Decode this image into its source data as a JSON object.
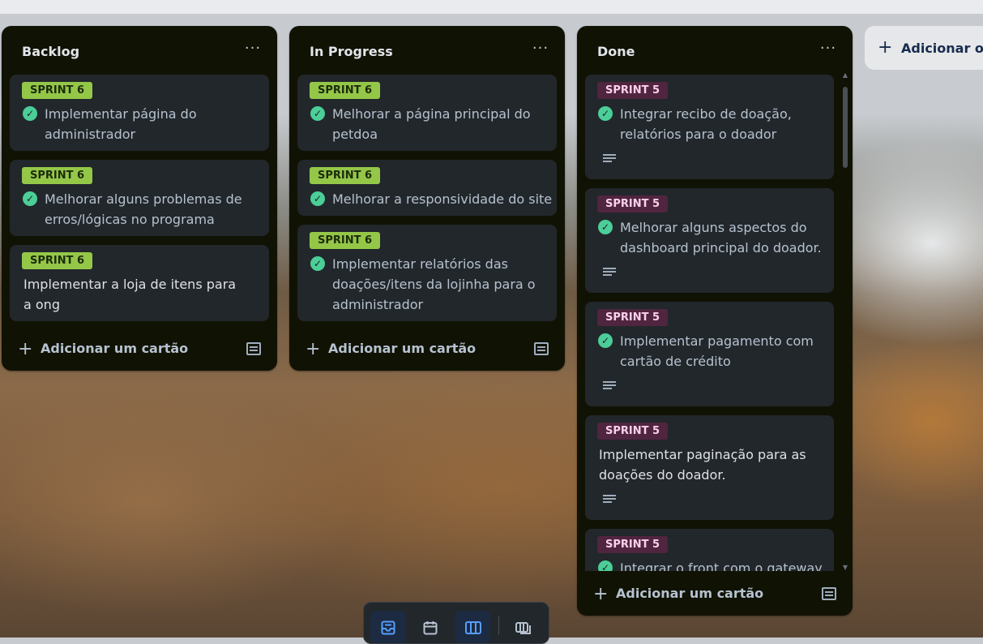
{
  "lists": [
    {
      "title": "Backlog",
      "menu": "···",
      "add_label": "Adicionar um cartão",
      "cards": [
        {
          "label": "SPRINT 6",
          "done": true,
          "lines": [
            "Implementar página do",
            "administrador"
          ]
        },
        {
          "label": "SPRINT 6",
          "done": true,
          "lines": [
            "Melhorar alguns problemas de",
            "erros/lógicas no programa"
          ]
        },
        {
          "label": "SPRINT 6",
          "done": false,
          "lines": [
            "Implementar a loja de itens para",
            "a ong"
          ]
        }
      ]
    },
    {
      "title": "In Progress",
      "menu": "···",
      "add_label": "Adicionar um cartão",
      "cards": [
        {
          "label": "SPRINT 6",
          "done": true,
          "lines": [
            "Melhorar a página principal do",
            "petdoa"
          ]
        },
        {
          "label": "SPRINT 6",
          "done": true,
          "lines": [
            "Melhorar a responsividade do site"
          ]
        },
        {
          "label": "SPRINT 6",
          "done": true,
          "lines": [
            "Implementar relatórios das",
            "doações/itens da lojinha para o",
            "administrador"
          ]
        }
      ]
    },
    {
      "title": "Done",
      "menu": "···",
      "add_label": "Adicionar um cartão",
      "cards": [
        {
          "label": "SPRINT 5",
          "done": true,
          "lines": [
            "Integrar recibo de doação,",
            "relatórios para o doador"
          ],
          "has_description": true
        },
        {
          "label": "SPRINT 5",
          "done": true,
          "lines": [
            "Melhorar alguns aspectos do",
            "dashboard principal do doador."
          ],
          "has_description": true
        },
        {
          "label": "SPRINT 5",
          "done": true,
          "lines": [
            "Implementar pagamento com",
            "cartão de crédito"
          ],
          "has_description": true
        },
        {
          "label": "SPRINT 5",
          "done": false,
          "lines": [
            "Implementar paginação para as",
            "doações do doador."
          ],
          "has_description": true
        },
        {
          "label": "SPRINT 5",
          "done": true,
          "lines": [
            "Integrar o front com o gateway"
          ]
        }
      ]
    }
  ],
  "add_list_label": "Adicionar ou",
  "colors": {
    "list_bg": "#101204",
    "card_bg": "#22272b",
    "label_sprint6": "#94c748",
    "label_sprint5": "#50253f",
    "check": "#4bce97"
  },
  "dock": {
    "buttons": [
      {
        "icon": "inbox-icon",
        "active": true
      },
      {
        "icon": "calendar-icon",
        "active": false
      },
      {
        "icon": "board-icon",
        "active": true
      },
      {
        "icon": "switch-boards-icon",
        "active": false
      }
    ]
  }
}
